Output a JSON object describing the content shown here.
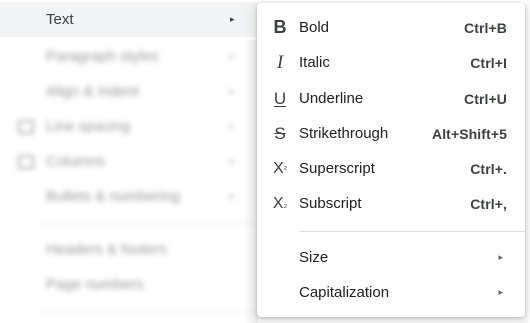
{
  "format_menu": {
    "items": [
      {
        "label": "Text",
        "active": true
      },
      {
        "label": "Paragraph styles"
      },
      {
        "label": "Align & indent"
      },
      {
        "label": "Line spacing"
      },
      {
        "label": "Columns"
      },
      {
        "label": "Bullets & numbering"
      },
      {
        "label": "Headers & footers"
      },
      {
        "label": "Page numbers"
      }
    ],
    "submenu_arrow": "▸"
  },
  "text_submenu": {
    "items": [
      {
        "label": "Bold",
        "shortcut": "Ctrl+B",
        "icon": "bold-icon",
        "glyph": "B"
      },
      {
        "label": "Italic",
        "shortcut": "Ctrl+I",
        "icon": "italic-icon",
        "glyph": "I"
      },
      {
        "label": "Underline",
        "shortcut": "Ctrl+U",
        "icon": "underline-icon",
        "glyph": "U"
      },
      {
        "label": "Strikethrough",
        "shortcut": "Alt+Shift+5",
        "icon": "strikethrough-icon",
        "glyph": "S"
      },
      {
        "label": "Superscript",
        "shortcut": "Ctrl+.",
        "icon": "superscript-icon",
        "glyph": "X",
        "glyph_mark": "²"
      },
      {
        "label": "Subscript",
        "shortcut": "Ctrl+,",
        "icon": "subscript-icon",
        "glyph": "X",
        "glyph_mark": "₂"
      },
      {
        "label": "Size",
        "icon": "none"
      },
      {
        "label": "Capitalization",
        "icon": "none"
      }
    ],
    "submenu_arrow": "▸"
  },
  "colors": {
    "active_row": "#f1f3f4",
    "text": "#202124",
    "shortcut": "#3c4043",
    "divider": "#dadce0"
  }
}
